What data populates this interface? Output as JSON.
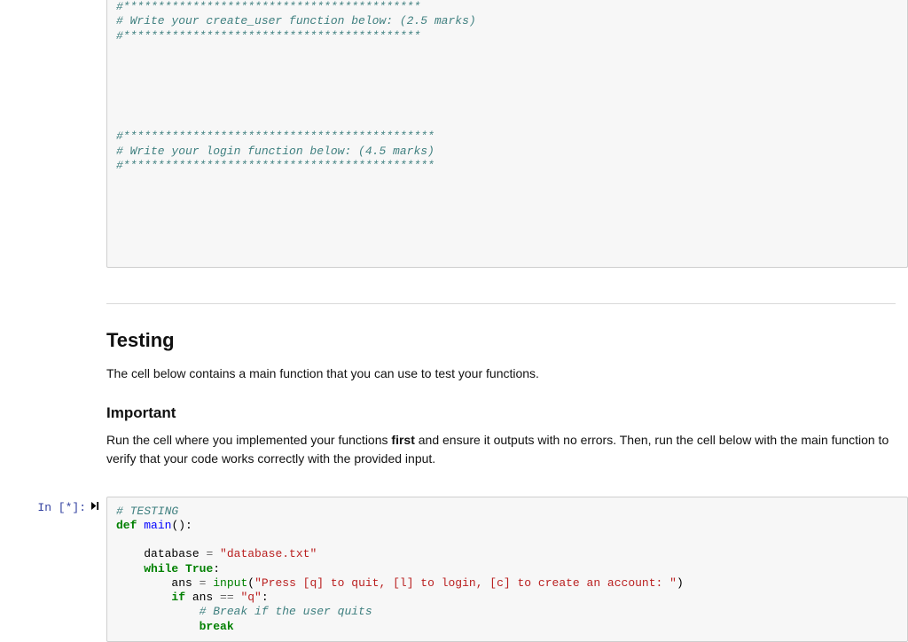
{
  "cell1": {
    "code": {
      "line1": "#*******************************************",
      "line2": "# Write your create_user function below: (2.5 marks)",
      "line3": "#*******************************************",
      "line4": "#*********************************************",
      "line5": "# Write your login function below: (4.5 marks)",
      "line6": "#*********************************************"
    }
  },
  "markdown": {
    "h_testing": "Testing",
    "p_testing": "The cell below contains a main function that you can use to test your functions.",
    "h_important": "Important",
    "p_important_pre": "Run the cell where you implemented your functions ",
    "p_important_first": "first",
    "p_important_post": " and ensure it outputs with no errors. Then, run the cell below with the main function to verify that your code works correctly with the provided input."
  },
  "cell2": {
    "prompt": "In [*]:",
    "code": {
      "c1": "# TESTING",
      "kw_def": "def",
      "fn_main": "main",
      "paren_main": "():",
      "var_db": "database",
      "eq1": " = ",
      "str_db": "\"database.txt\"",
      "kw_while": "while",
      "const_true": "True",
      "colon1": ":",
      "var_ans": "ans",
      "eq2": " = ",
      "builtin_input": "input",
      "paren_input_o": "(",
      "str_prompt": "\"Press [q] to quit, [l] to login, [c] to create an account: \"",
      "paren_input_c": ")",
      "kw_if": "if",
      "var_ans2": " ans ",
      "op_eq": "==",
      "str_q": " \"q\"",
      "colon2": ":",
      "c2": "# Break if the user quits",
      "kw_break": "break"
    }
  }
}
